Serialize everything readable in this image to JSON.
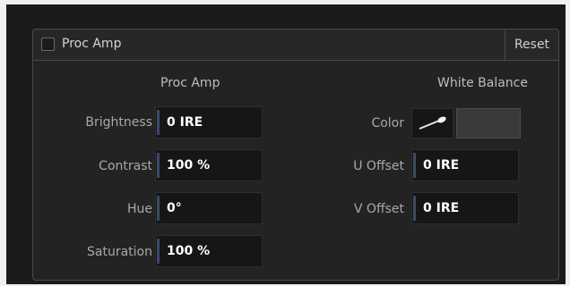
{
  "header": {
    "title": "Proc Amp",
    "enabled": false,
    "reset_label": "Reset"
  },
  "proc_amp": {
    "title": "Proc Amp",
    "fields": [
      {
        "label": "Brightness",
        "value": "0 IRE"
      },
      {
        "label": "Contrast",
        "value": "100 %"
      },
      {
        "label": "Hue",
        "value": "0°"
      },
      {
        "label": "Saturation",
        "value": "100 %"
      }
    ]
  },
  "white_balance": {
    "title": "White Balance",
    "color_label": "Color",
    "eyedropper_icon": "eyedropper-icon",
    "swatch_color": "#3a3a3a",
    "fields": [
      {
        "label": "U Offset",
        "value": "0 IRE"
      },
      {
        "label": "V Offset",
        "value": "0 IRE"
      }
    ]
  },
  "colors": {
    "panel_bg": "#232323",
    "field_bg": "#161616",
    "accent": "#3a4a6a"
  }
}
